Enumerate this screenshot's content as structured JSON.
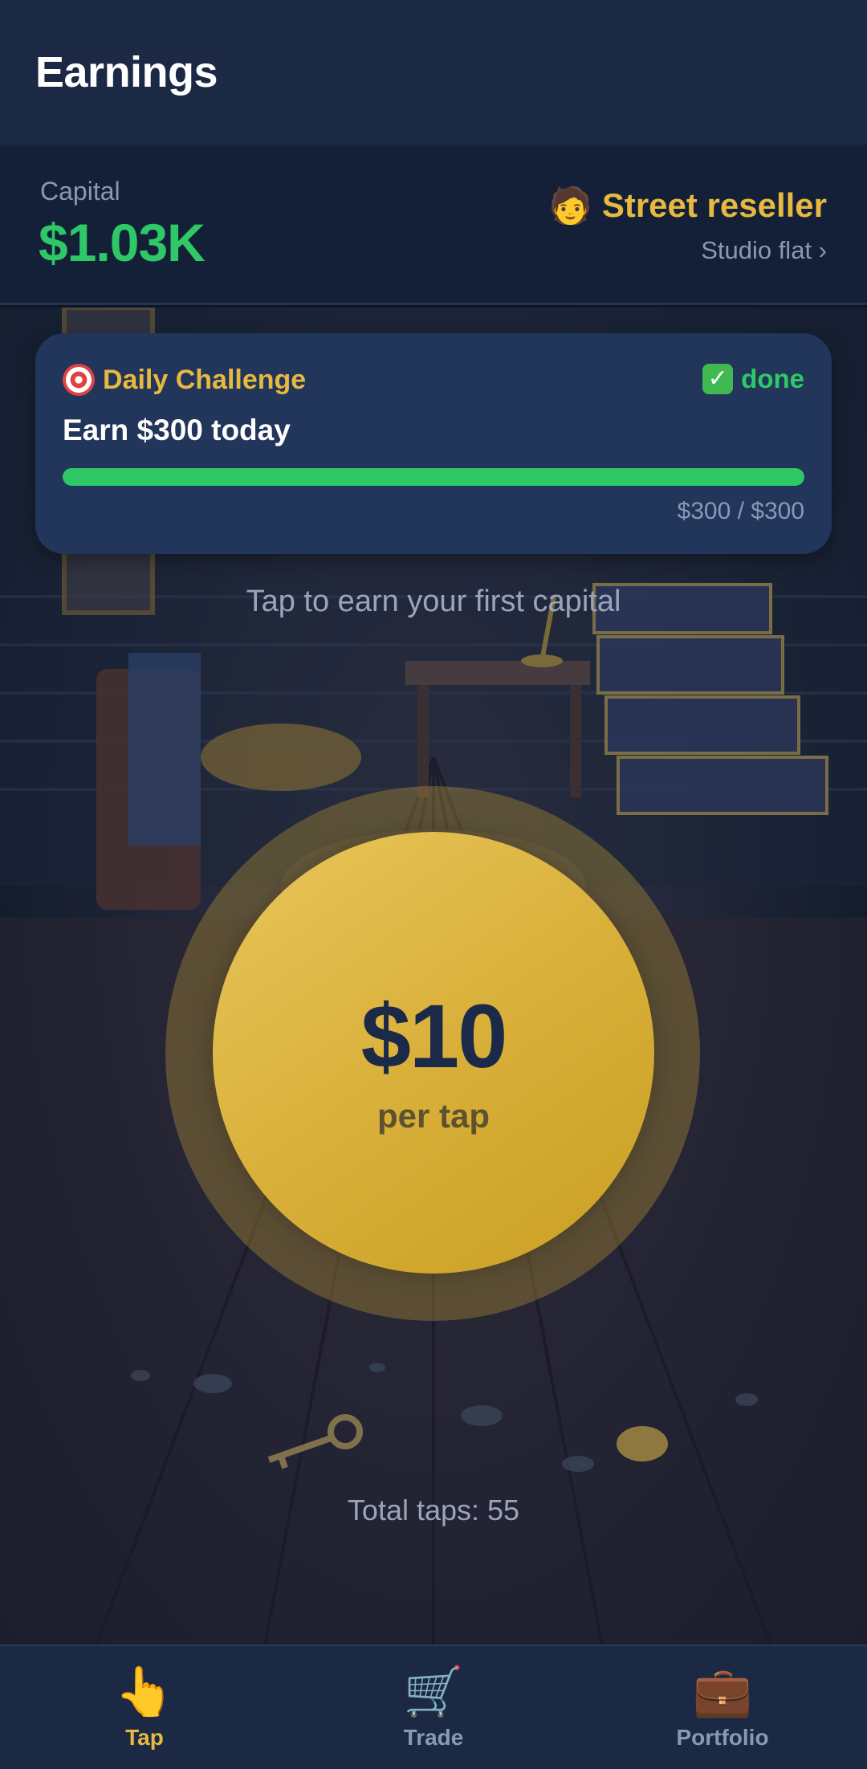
{
  "header": {
    "title": "Earnings"
  },
  "capital": {
    "label": "Capital",
    "value": "$1.03K",
    "rank_emoji": "🧑",
    "rank_title": "Street reseller",
    "rank_sub": "Studio flat ›"
  },
  "challenge": {
    "icon": "target-icon",
    "title": "Daily Challenge",
    "status_icon": "check-icon",
    "status_mark": "✓",
    "status": "done",
    "goal": "Earn $300 today",
    "progress_text": "$300 / $300",
    "progress_fraction": 1.0
  },
  "main": {
    "hint": "Tap to earn your first capital",
    "tap_amount": "$10",
    "tap_unit": "per tap",
    "total_taps": "Total taps: 55"
  },
  "nav": {
    "items": [
      {
        "label": "Tap",
        "icon": "pointing-hand-icon",
        "glyph": "👆",
        "active": true
      },
      {
        "label": "Trade",
        "icon": "shopping-cart-icon",
        "glyph": "🛒",
        "active": false
      },
      {
        "label": "Portfolio",
        "icon": "briefcase-icon",
        "glyph": "💼",
        "active": false
      }
    ]
  },
  "colors": {
    "accent_gold": "#e7b93f",
    "money_green": "#2ec966",
    "header_bg": "#1b2945",
    "card_bg": "#22355a"
  }
}
